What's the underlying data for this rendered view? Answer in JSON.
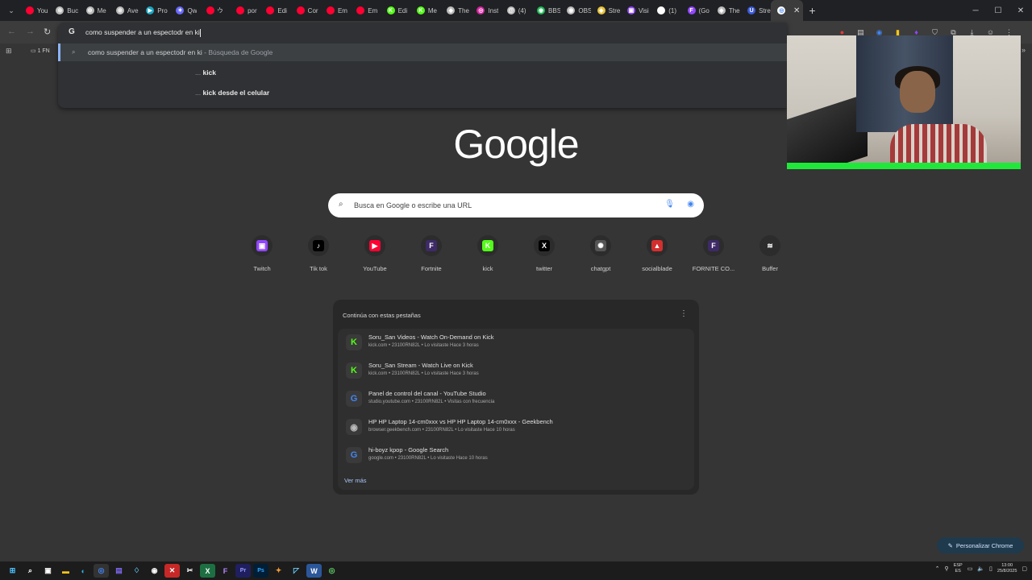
{
  "tabs": [
    {
      "label": "You",
      "color": "#ff0033",
      "glyph": ""
    },
    {
      "label": "Buc",
      "color": "#bbbbbb",
      "glyph": "⊚"
    },
    {
      "label": "Me",
      "color": "#bbbbbb",
      "glyph": "⊚"
    },
    {
      "label": "Ave",
      "color": "#bbbbbb",
      "glyph": "⊚"
    },
    {
      "label": "Pro",
      "color": "#1aa7c4",
      "glyph": "▶"
    },
    {
      "label": "Qw",
      "color": "#6a6aff",
      "glyph": "✶"
    },
    {
      "label": "לי",
      "color": "#ff0033",
      "glyph": ""
    },
    {
      "label": "por",
      "color": "#ff0033",
      "glyph": ""
    },
    {
      "label": "Edi",
      "color": "#ff0033",
      "glyph": ""
    },
    {
      "label": "Cor",
      "color": "#ff0033",
      "glyph": ""
    },
    {
      "label": "Em",
      "color": "#ff0033",
      "glyph": ""
    },
    {
      "label": "Em",
      "color": "#ff0033",
      "glyph": ""
    },
    {
      "label": "Edi",
      "color": "#53fc18",
      "glyph": "K"
    },
    {
      "label": "Me",
      "color": "#53fc18",
      "glyph": "K"
    },
    {
      "label": "The",
      "color": "#bbbbbb",
      "glyph": "◆"
    },
    {
      "label": "Inst",
      "color": "#d6249f",
      "glyph": "◎"
    },
    {
      "label": "(4)",
      "color": "#bbbbbb",
      "glyph": "@"
    },
    {
      "label": "BBS",
      "color": "#1db954",
      "glyph": "◉"
    },
    {
      "label": "OBS",
      "color": "#bbbbbb",
      "glyph": "◉"
    },
    {
      "label": "Stre",
      "color": "#e8c43a",
      "glyph": "◆"
    },
    {
      "label": "Visi",
      "color": "#9146ff",
      "glyph": "▣"
    },
    {
      "label": "(1)",
      "color": "#ffffff",
      "glyph": "X"
    },
    {
      "label": "(Go",
      "color": "#9146ff",
      "glyph": "F"
    },
    {
      "label": "The",
      "color": "#bbbbbb",
      "glyph": "◆"
    },
    {
      "label": "Stre",
      "color": "#3b5bdb",
      "glyph": "U"
    }
  ],
  "window_controls": {
    "minimize": "─",
    "maximize": "☐",
    "close": "✕"
  },
  "toolbar": {
    "back": "←",
    "forward": "→",
    "reload": "↻"
  },
  "omnibox": {
    "value": "como suspender a un espectodr en ki",
    "suggestions": [
      {
        "text": "como suspender a un espectodr en ki",
        "hint": " - Búsqueda de Google"
      },
      {
        "prefix": "...",
        "bold": "kick"
      },
      {
        "prefix": "...",
        "bold": "kick desde el celular"
      }
    ]
  },
  "bookmarks": {
    "folder": "1 FN"
  },
  "ntp": {
    "logo": "Google",
    "search_placeholder": "Busca en Google o escribe una URL",
    "shortcuts": [
      {
        "label": "Twitch",
        "color": "#9146ff",
        "glyph": "▣"
      },
      {
        "label": "Tik tok",
        "color": "#000000",
        "glyph": "♪"
      },
      {
        "label": "YouTube",
        "color": "#ff0033",
        "glyph": "▶"
      },
      {
        "label": "Fortnite",
        "color": "#3d2a66",
        "glyph": "F"
      },
      {
        "label": "kick",
        "color": "#53fc18",
        "glyph": "K"
      },
      {
        "label": "twitter",
        "color": "#000000",
        "glyph": "X"
      },
      {
        "label": "chatgpt",
        "color": "#555555",
        "glyph": "✺"
      },
      {
        "label": "socialblade",
        "color": "#d32f2f",
        "glyph": "▲"
      },
      {
        "label": "FORNITE CO...",
        "color": "#3d2a66",
        "glyph": "F"
      },
      {
        "label": "Buffer",
        "color": "#2c2c2c",
        "glyph": "≋"
      }
    ],
    "continue_title": "Continúa con estas pestañas",
    "cards": [
      {
        "title": "Soru_San Videos - Watch On-Demand on Kick",
        "sub": "kick.com • 23100RN82L • Lo visitaste Hace 3 horas",
        "glyph": "K",
        "color": "#53fc18"
      },
      {
        "title": "Soru_San Stream - Watch Live on Kick",
        "sub": "kick.com • 23100RN82L • Lo visitaste Hace 3 horas",
        "glyph": "K",
        "color": "#53fc18"
      },
      {
        "title": "Panel de control del canal - YouTube Studio",
        "sub": "studio.youtube.com • 23100RN82L • Visitas con frecuencia",
        "glyph": "G",
        "color": "#4285f4"
      },
      {
        "title": "HP HP Laptop 14-cm0xxx vs HP HP Laptop 14-cm0xxx - Geekbench",
        "sub": "browser.geekbench.com • 23100RN82L • Lo visitaste Hace 10 horas",
        "glyph": "◉",
        "color": "#bbbbbb"
      },
      {
        "title": "hi-boyz kpop - Google Search",
        "sub": "google.com • 23100RN82L • Lo visitaste Hace 10 horas",
        "glyph": "G",
        "color": "#4285f4"
      }
    ],
    "see_more": "Ver más",
    "personalize": "Personalizar Chrome"
  },
  "tray": {
    "lang_top": "ESP",
    "lang_bottom": "ES",
    "time": "13:00",
    "date": "25/8/2025"
  }
}
